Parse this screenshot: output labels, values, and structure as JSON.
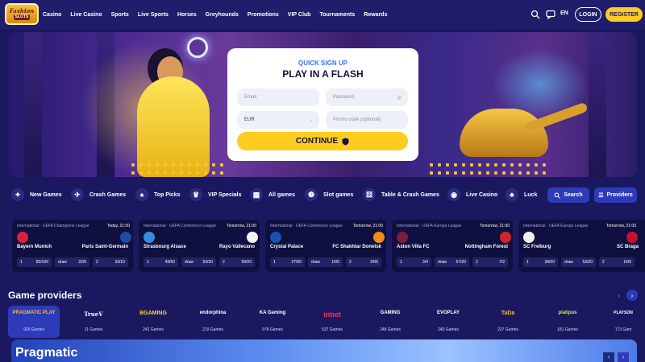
{
  "brand": {
    "line1": "Fashion",
    "line2": "SLOTS"
  },
  "nav": [
    "Casino",
    "Live Casino",
    "Sports",
    "Live Sports",
    "Horses",
    "Greyhounds",
    "Promotions",
    "VIP Club",
    "Tournaments",
    "Rewards"
  ],
  "header": {
    "lang": "EN",
    "login": "LOGIN",
    "register": "REGISTER"
  },
  "signup": {
    "subtitle": "QUICK SIGN UP",
    "title": "PLAY IN A FLASH",
    "email_placeholder": "Email",
    "password_placeholder": "Password",
    "currency": "EUR",
    "promo_placeholder": "Promo code (optional)",
    "continue": "CONTINUE"
  },
  "categories": [
    "New Games",
    "Crash Games",
    "Top Picks",
    "VIP Specials",
    "All games",
    "Slot games",
    "Table & Crash Games",
    "Live Casino",
    "Luck"
  ],
  "search_label": "Search",
  "providers_label": "Providers",
  "matches": [
    {
      "league": "International · UEFA Champions League",
      "time": "Today, 21:00",
      "home": "Bayern Munich",
      "away": "Paris Saint-Germain",
      "o1": "83/100",
      "ox": "22/5",
      "o2": "33/10"
    },
    {
      "league": "International · UEFA Conference League",
      "time": "Tomorrow, 21:00",
      "home": "Strasbourg Alsace",
      "away": "Rayo Vallecano",
      "o1": "43/50",
      "ox": "53/20",
      "o2": "59/20"
    },
    {
      "league": "International · UEFA Conference League",
      "time": "Tomorrow, 21:00",
      "home": "Crystal Palace",
      "away": "FC Shakhtar Donetsk",
      "o1": "27/50",
      "ox": "16/5",
      "o2": "24/5"
    },
    {
      "league": "International · UEFA Europa League",
      "time": "Tomorrow, 21:00",
      "home": "Aston Villa FC",
      "away": "Nottingham Forest",
      "o1": "3/4",
      "ox": "57/20",
      "o2": "7/2"
    },
    {
      "league": "International · UEFA Europa League",
      "time": "Tomorrow, 21:00",
      "home": "SC Freiburg",
      "away": "SC Braga",
      "o1": "39/50",
      "ox": "53/20",
      "o2": "16/5"
    }
  ],
  "odds_labels": {
    "one": "1",
    "draw": "draw",
    "two": "2"
  },
  "providers_title": "Game providers",
  "providers": [
    {
      "name": "PRAGMATIC PLAY",
      "count": "926 Games"
    },
    {
      "name": "TrueV",
      "count": "11 Games"
    },
    {
      "name": "BGAMING",
      "count": "242 Games"
    },
    {
      "name": "endorphina",
      "count": "219 Games"
    },
    {
      "name": "KA Gaming",
      "count": "978 Games"
    },
    {
      "name": "inbet",
      "count": "537 Games"
    },
    {
      "name": "GAMING",
      "count": "248 Games"
    },
    {
      "name": "EVOPLAY",
      "count": "240 Games"
    },
    {
      "name": "TaDa",
      "count": "227 Games"
    },
    {
      "name": "platipus",
      "count": "181 Games"
    },
    {
      "name": "PLAYSON",
      "count": "173 Gam"
    }
  ],
  "banner_title": "Pragmatic",
  "colors": {
    "accent": "#ffcc1f",
    "bg": "#1a1960",
    "blue": "#3b6ef5"
  }
}
